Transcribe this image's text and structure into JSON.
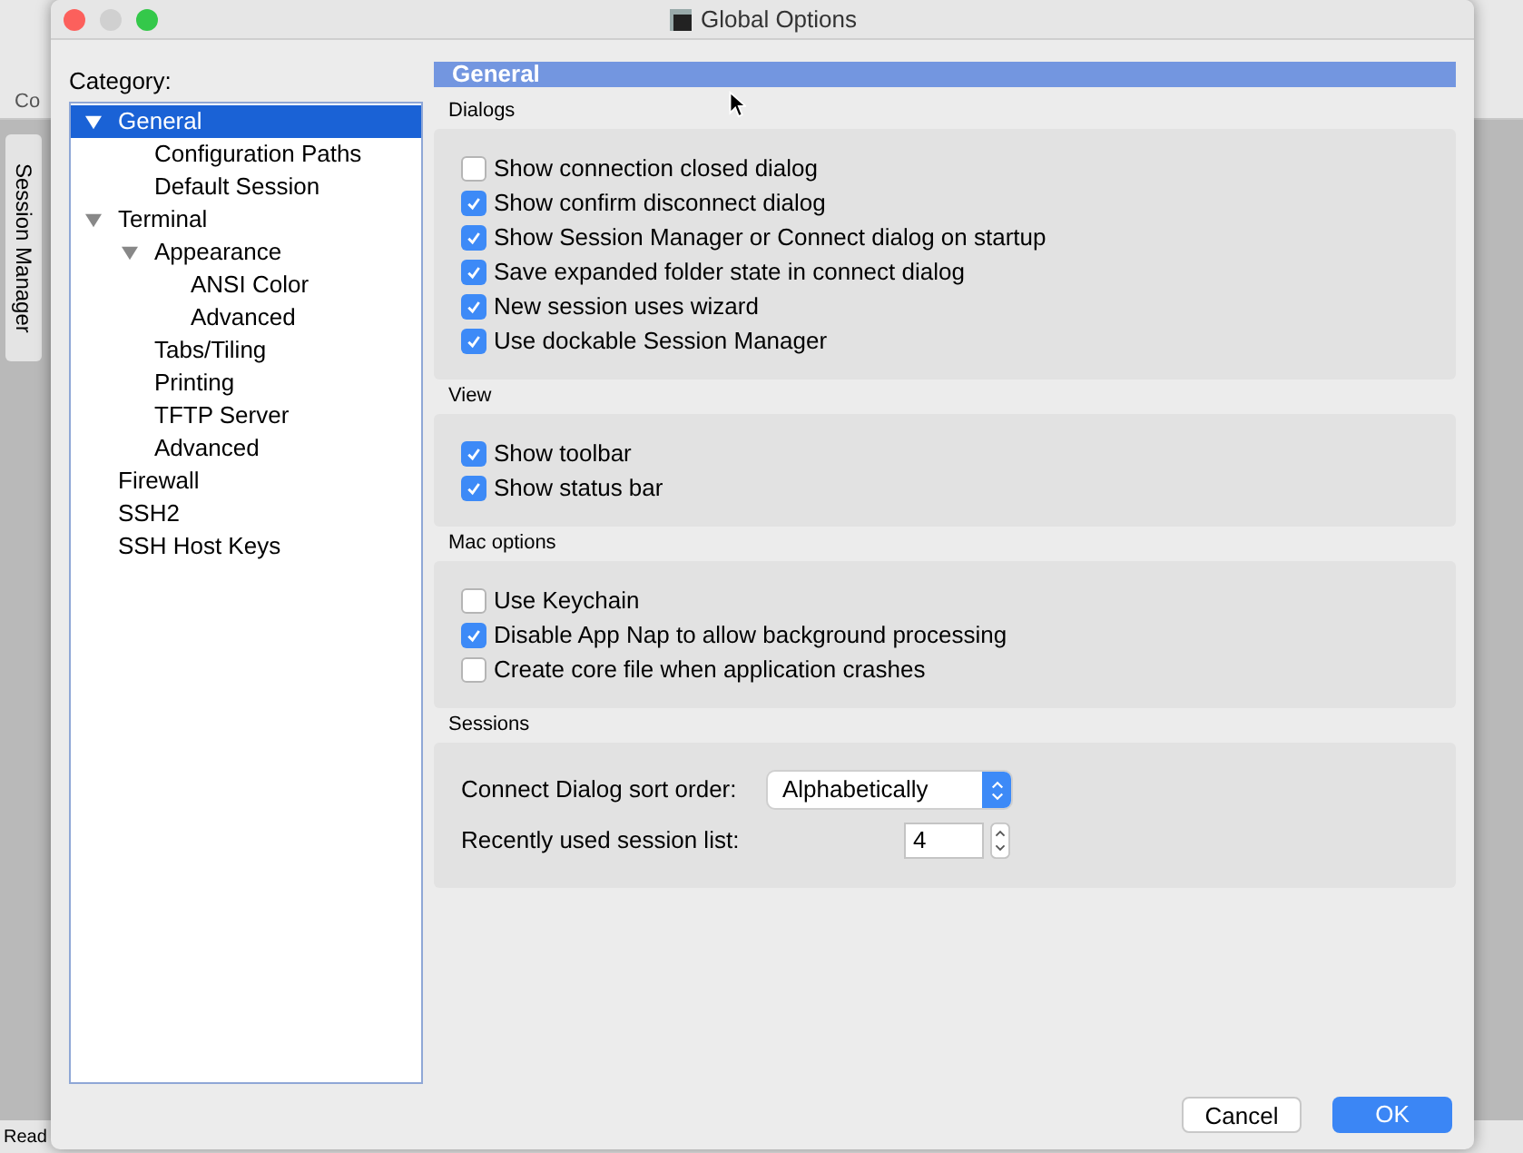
{
  "background_app": {
    "toolbar_label": "Co",
    "side_tab": "Session Manager",
    "status_bar": "Read"
  },
  "window": {
    "title": "Global Options"
  },
  "category_label": "Category:",
  "tree": [
    {
      "label": "General",
      "expanded": true,
      "selected": true,
      "children": [
        {
          "label": "Configuration Paths",
          "selected": false
        },
        {
          "label": "Default Session",
          "selected": false
        }
      ]
    },
    {
      "label": "Terminal",
      "expanded": true,
      "selected": false,
      "children": [
        {
          "label": "Appearance",
          "expanded": true,
          "selected": false,
          "children": [
            {
              "label": "ANSI Color",
              "selected": false
            },
            {
              "label": "Advanced",
              "selected": false
            }
          ]
        },
        {
          "label": "Tabs/Tiling",
          "selected": false
        },
        {
          "label": "Printing",
          "selected": false
        },
        {
          "label": "TFTP Server",
          "selected": false
        },
        {
          "label": "Advanced",
          "selected": false
        }
      ]
    },
    {
      "label": "Firewall",
      "selected": false
    },
    {
      "label": "SSH2",
      "selected": false
    },
    {
      "label": "SSH Host Keys",
      "selected": false
    }
  ],
  "panel": {
    "title": "General",
    "sections": [
      {
        "title": "Dialogs",
        "items": [
          {
            "kind": "checkbox",
            "label": "Show connection closed dialog",
            "checked": false
          },
          {
            "kind": "checkbox",
            "label": "Show confirm disconnect dialog",
            "checked": true
          },
          {
            "kind": "checkbox",
            "label": "Show Session Manager or Connect dialog on startup",
            "checked": true
          },
          {
            "kind": "checkbox",
            "label": "Save expanded folder state in connect dialog",
            "checked": true
          },
          {
            "kind": "checkbox",
            "label": "New session uses wizard",
            "checked": true
          },
          {
            "kind": "checkbox",
            "label": "Use dockable Session Manager",
            "checked": true
          }
        ]
      },
      {
        "title": "View",
        "items": [
          {
            "kind": "checkbox",
            "label": "Show toolbar",
            "checked": true
          },
          {
            "kind": "checkbox",
            "label": "Show status bar",
            "checked": true
          }
        ]
      },
      {
        "title": "Mac options",
        "items": [
          {
            "kind": "checkbox",
            "label": "Use Keychain",
            "checked": false
          },
          {
            "kind": "checkbox",
            "label": "Disable App Nap to allow background processing",
            "checked": true
          },
          {
            "kind": "checkbox",
            "label": "Create core file when application crashes",
            "checked": false
          }
        ]
      },
      {
        "title": "Sessions",
        "items": [
          {
            "kind": "select",
            "label": "Connect Dialog sort order:",
            "value": "Alphabetically"
          },
          {
            "kind": "stepper",
            "label": "Recently used session list:",
            "value": "4"
          }
        ]
      }
    ]
  },
  "buttons": [
    {
      "label": "Cancel",
      "kind": "secondary"
    },
    {
      "label": "OK",
      "kind": "primary"
    }
  ]
}
